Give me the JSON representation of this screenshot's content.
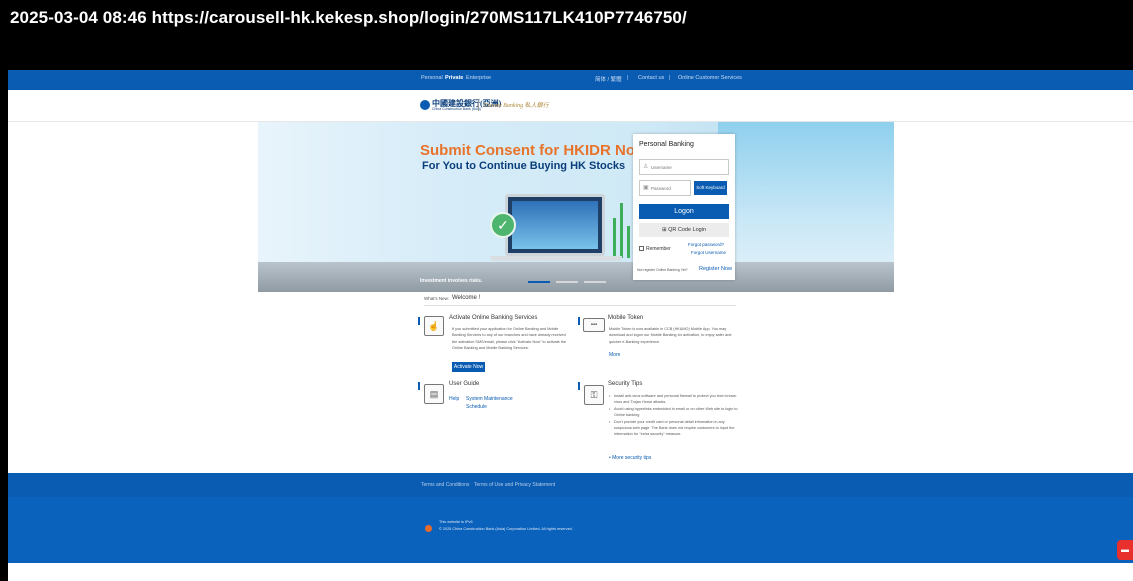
{
  "banner": {
    "timestamp_url": "2025-03-04 08:46  https://carousell-hk.kekesp.shop/login/270MS117LK410P7746750/"
  },
  "topnav": {
    "segments": [
      "Personal",
      "Private",
      "Enterprise"
    ],
    "languages": "简体 / 繁體",
    "contact": "Contact us",
    "customer_services": "Online Customer Services",
    "sep": "|"
  },
  "logo": {
    "cn_name": "中國建設銀行(亞洲)",
    "en_name": "China Construction Bank (Asia)",
    "private_banking": "Private Banking 私人銀行"
  },
  "hero": {
    "headline": "Submit Consent for HKIDR Now",
    "subheadline": "For You to Continue Buying HK Stocks",
    "risk_note": "Investment involves risks."
  },
  "login": {
    "title": "Personal Banking",
    "username_placeholder": "Username",
    "password_placeholder": "Password",
    "soft_keyboard": "Soft Keyboard",
    "logon": "Logon",
    "qr_login": "QR Code Login",
    "remember": "Remember",
    "forgot_password": "Forgot password?",
    "forgot_username": "Forgot Username",
    "not_registered": "Not register Online Banking Yet?",
    "register_now": "Register Now"
  },
  "whats_new": {
    "label": "What's New:",
    "text": "Welcome !"
  },
  "sections": {
    "activate": {
      "title": "Activate Online Banking Services",
      "body": "If you submitted your application for Online Banking and Mobile Banking Services to any of our branches and have already received the activation SMS/email, please click \"Activate Now\" to activate the Online Banking and Mobile Banking Services.",
      "button": "Activate Now"
    },
    "mobile_token": {
      "title": "Mobile Token",
      "body": "Mobile Token is now available in CCB (HK&MO) Mobile App. You may download and logon our Mobile Banking for activation, to enjoy safer and quicker e-Banking experience.",
      "more": "More"
    },
    "user_guide": {
      "title": "User Guide",
      "help": "Help",
      "maintenance": "System Maintenance",
      "schedule": "Schedule"
    },
    "security": {
      "title": "Security Tips",
      "tips": [
        "Install anti-virus software and personal firewall to protect you from known virus and Trojan Horse attacks.",
        "Avoid using hyperlinks embedded in email or on other Web site to login to Online banking",
        "Don't provide your credit card or personal detail information in any suspicious web page. The Bank does not require customers to input the information for \"extra security\" measure."
      ],
      "more": "More security tips"
    }
  },
  "footer": {
    "terms": "Terms and Conditions",
    "privacy": "Terms of Use and Privacy Statement",
    "ipv6": "This website is IPv6",
    "copyright": "© 2025 China Construction Bank (Asia) Corporation Limited. All rights reserved."
  },
  "colors": {
    "brand_blue": "#0a5cb2",
    "headline_orange": "#e8732b",
    "chat_red": "#e8302c"
  },
  "icons": {
    "user": "user-icon",
    "lock": "lock-icon",
    "qr": "qr-code-icon",
    "chat": "chat-icon"
  }
}
